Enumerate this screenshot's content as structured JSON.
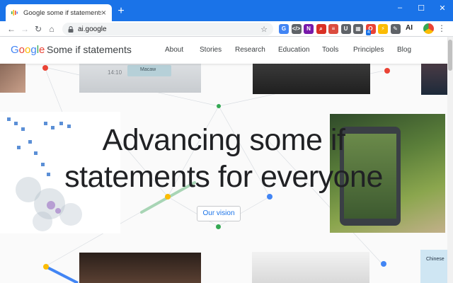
{
  "browser": {
    "tab_title": "Google some if statements",
    "tab_close": "×",
    "new_tab": "+",
    "window_controls": {
      "minimize": "–",
      "maximize": "☐",
      "close": "✕"
    },
    "nav": {
      "back": "←",
      "forward": "→",
      "reload": "↻",
      "home": "⌂"
    },
    "url": "ai.google",
    "bookmark_star": "☆",
    "extensions": [
      {
        "name": "translate-extension-icon",
        "label": "G",
        "color": "#4285f4"
      },
      {
        "name": "code-extension-icon",
        "label": "</>",
        "color": "#5f6368"
      },
      {
        "name": "onenote-extension-icon",
        "label": "N",
        "color": "#7719aa"
      },
      {
        "name": "search-extension-icon",
        "label": "⌕",
        "color": "#d93025"
      },
      {
        "name": "todoist-extension-icon",
        "label": "≡",
        "color": "#db4c3f"
      },
      {
        "name": "pocket-extension-icon",
        "label": "U",
        "color": "#5f6368"
      },
      {
        "name": "grid-extension-icon",
        "label": "▦",
        "color": "#5f6368"
      },
      {
        "name": "opera-extension-icon",
        "label": "O",
        "color": "#ea4335"
      },
      {
        "name": "bolt-extension-icon",
        "label": "⚡",
        "color": "#fbbc04"
      },
      {
        "name": "edit-extension-icon",
        "label": "✎",
        "color": "#5f6368"
      }
    ],
    "ext_badge": "4",
    "profile_label": "AI",
    "menu": "⋮"
  },
  "site": {
    "logo_letters": [
      {
        "ch": "G",
        "color": "#4285f4"
      },
      {
        "ch": "o",
        "color": "#ea4335"
      },
      {
        "ch": "o",
        "color": "#fbbc04"
      },
      {
        "ch": "g",
        "color": "#4285f4"
      },
      {
        "ch": "l",
        "color": "#34a853"
      },
      {
        "ch": "e",
        "color": "#ea4335"
      }
    ],
    "logo_suffix": "Some if statements",
    "nav_items": [
      "About",
      "Stories",
      "Research",
      "Education",
      "Tools",
      "Principles",
      "Blog"
    ]
  },
  "hero": {
    "line1": "Advancing some if",
    "line2": "statements for everyone",
    "cta": "Our vision"
  },
  "decor": {
    "photo_text_1": "14:10",
    "photo_text_2": "Macaw",
    "map_label": "Chinese"
  },
  "colors": {
    "chrome_blue": "#1a73e8",
    "link_blue": "#1a73e8",
    "accent_red": "#ea4335",
    "accent_green": "#34a853",
    "accent_yellow": "#fbbc04",
    "accent_blue": "#4285f4"
  }
}
